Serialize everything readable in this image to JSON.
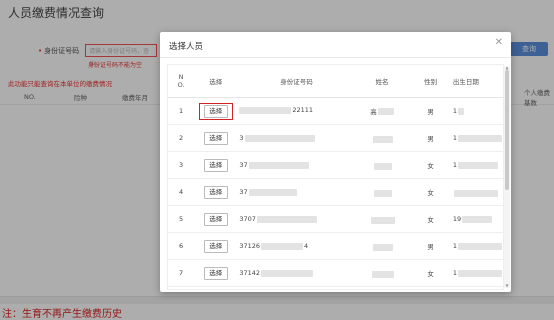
{
  "page": {
    "title": "人员缴费情况查询",
    "id_label": "身份证号码",
    "id_placeholder": "请输入身份证号码，查询",
    "id_error": "身份证号码不能为空",
    "notice": "此功能只能查询在本单位的缴费情况",
    "query_button": "查询",
    "table_headers": [
      "NO.",
      "险种",
      "缴费年月",
      "个人缴费基数"
    ],
    "foot_note": "注：生育不再产生缴费历史"
  },
  "modal": {
    "title": "选择人员",
    "close_icon": "close-icon",
    "headers": {
      "no_line1": "N",
      "no_line2": "O.",
      "select": "选择",
      "id": "身份证号码",
      "name": "姓名",
      "sex": "性别",
      "dob": "出生日期"
    },
    "select_label": "选择",
    "highlight_color": "#d32222",
    "rows": [
      {
        "no": "1",
        "id_prefix": "",
        "id_suffix": "22111",
        "name": "高",
        "sex": "男",
        "dob": "1",
        "highlighted": true
      },
      {
        "no": "2",
        "id_prefix": "3",
        "id_suffix": "",
        "name": "",
        "sex": "男",
        "dob": "1",
        "highlighted": false
      },
      {
        "no": "3",
        "id_prefix": "37",
        "id_suffix": "",
        "name": "",
        "sex": "女",
        "dob": "1",
        "highlighted": false
      },
      {
        "no": "4",
        "id_prefix": "37",
        "id_suffix": "",
        "name": "",
        "sex": "女",
        "dob": "",
        "highlighted": false
      },
      {
        "no": "5",
        "id_prefix": "3707",
        "id_suffix": "",
        "name": "",
        "sex": "女",
        "dob": "19",
        "highlighted": false
      },
      {
        "no": "6",
        "id_prefix": "37126",
        "id_suffix": "4",
        "name": "",
        "sex": "男",
        "dob": "1",
        "highlighted": false
      },
      {
        "no": "7",
        "id_prefix": "37142",
        "id_suffix": "",
        "name": "",
        "sex": "女",
        "dob": "1",
        "highlighted": false
      },
      {
        "no": "8",
        "id_prefix": "37082",
        "id_suffix": "",
        "name": "",
        "sex": "女",
        "dob": "19",
        "highlighted": false
      }
    ]
  }
}
